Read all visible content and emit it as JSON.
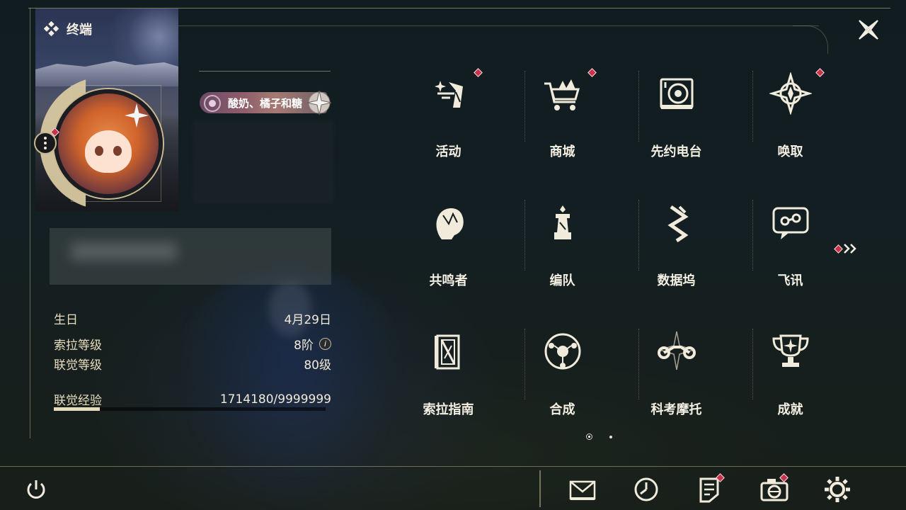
{
  "window": {
    "title": "终端",
    "accent_color": "#d7c8a0",
    "notice_color": "#c8324a"
  },
  "profile": {
    "name_badge": "酸奶、橘子和糖",
    "has_notification": true,
    "stats": [
      {
        "label": "生日",
        "value": "4月29日"
      },
      {
        "label": "索拉等级",
        "value": "8阶",
        "info": "i"
      },
      {
        "label": "联觉等级",
        "value": "80级"
      }
    ],
    "exp": {
      "label": "联觉经验",
      "value": "1714180/9999999",
      "progress": 0.17
    }
  },
  "menu": [
    {
      "label": "活动",
      "icon": "activity-icon",
      "badge": true
    },
    {
      "label": "商城",
      "icon": "shop-cart-icon",
      "badge": true
    },
    {
      "label": "先约电台",
      "icon": "radio-icon",
      "badge": false
    },
    {
      "label": "唤取",
      "icon": "summon-compass-icon",
      "badge": true
    },
    {
      "label": "共鸣者",
      "icon": "resonator-icon",
      "badge": false
    },
    {
      "label": "编队",
      "icon": "team-chess-icon",
      "badge": false
    },
    {
      "label": "数据坞",
      "icon": "data-dock-icon",
      "badge": false
    },
    {
      "label": "飞讯",
      "icon": "message-chat-icon",
      "badge": false
    },
    {
      "label": "索拉指南",
      "icon": "guide-book-icon",
      "badge": false
    },
    {
      "label": "合成",
      "icon": "synthesis-icon",
      "badge": false
    },
    {
      "label": "科考摩托",
      "icon": "motorbike-icon",
      "badge": false
    },
    {
      "label": "成就",
      "icon": "trophy-icon",
      "badge": false
    }
  ],
  "pager": {
    "current": 1,
    "total": 2
  },
  "bottom_bar": [
    {
      "icon": "mail-icon",
      "badge": false
    },
    {
      "icon": "clock-icon",
      "badge": false
    },
    {
      "icon": "notes-icon",
      "badge": true
    },
    {
      "icon": "camera-icon",
      "badge": true
    },
    {
      "icon": "gear-icon",
      "badge": false
    }
  ]
}
